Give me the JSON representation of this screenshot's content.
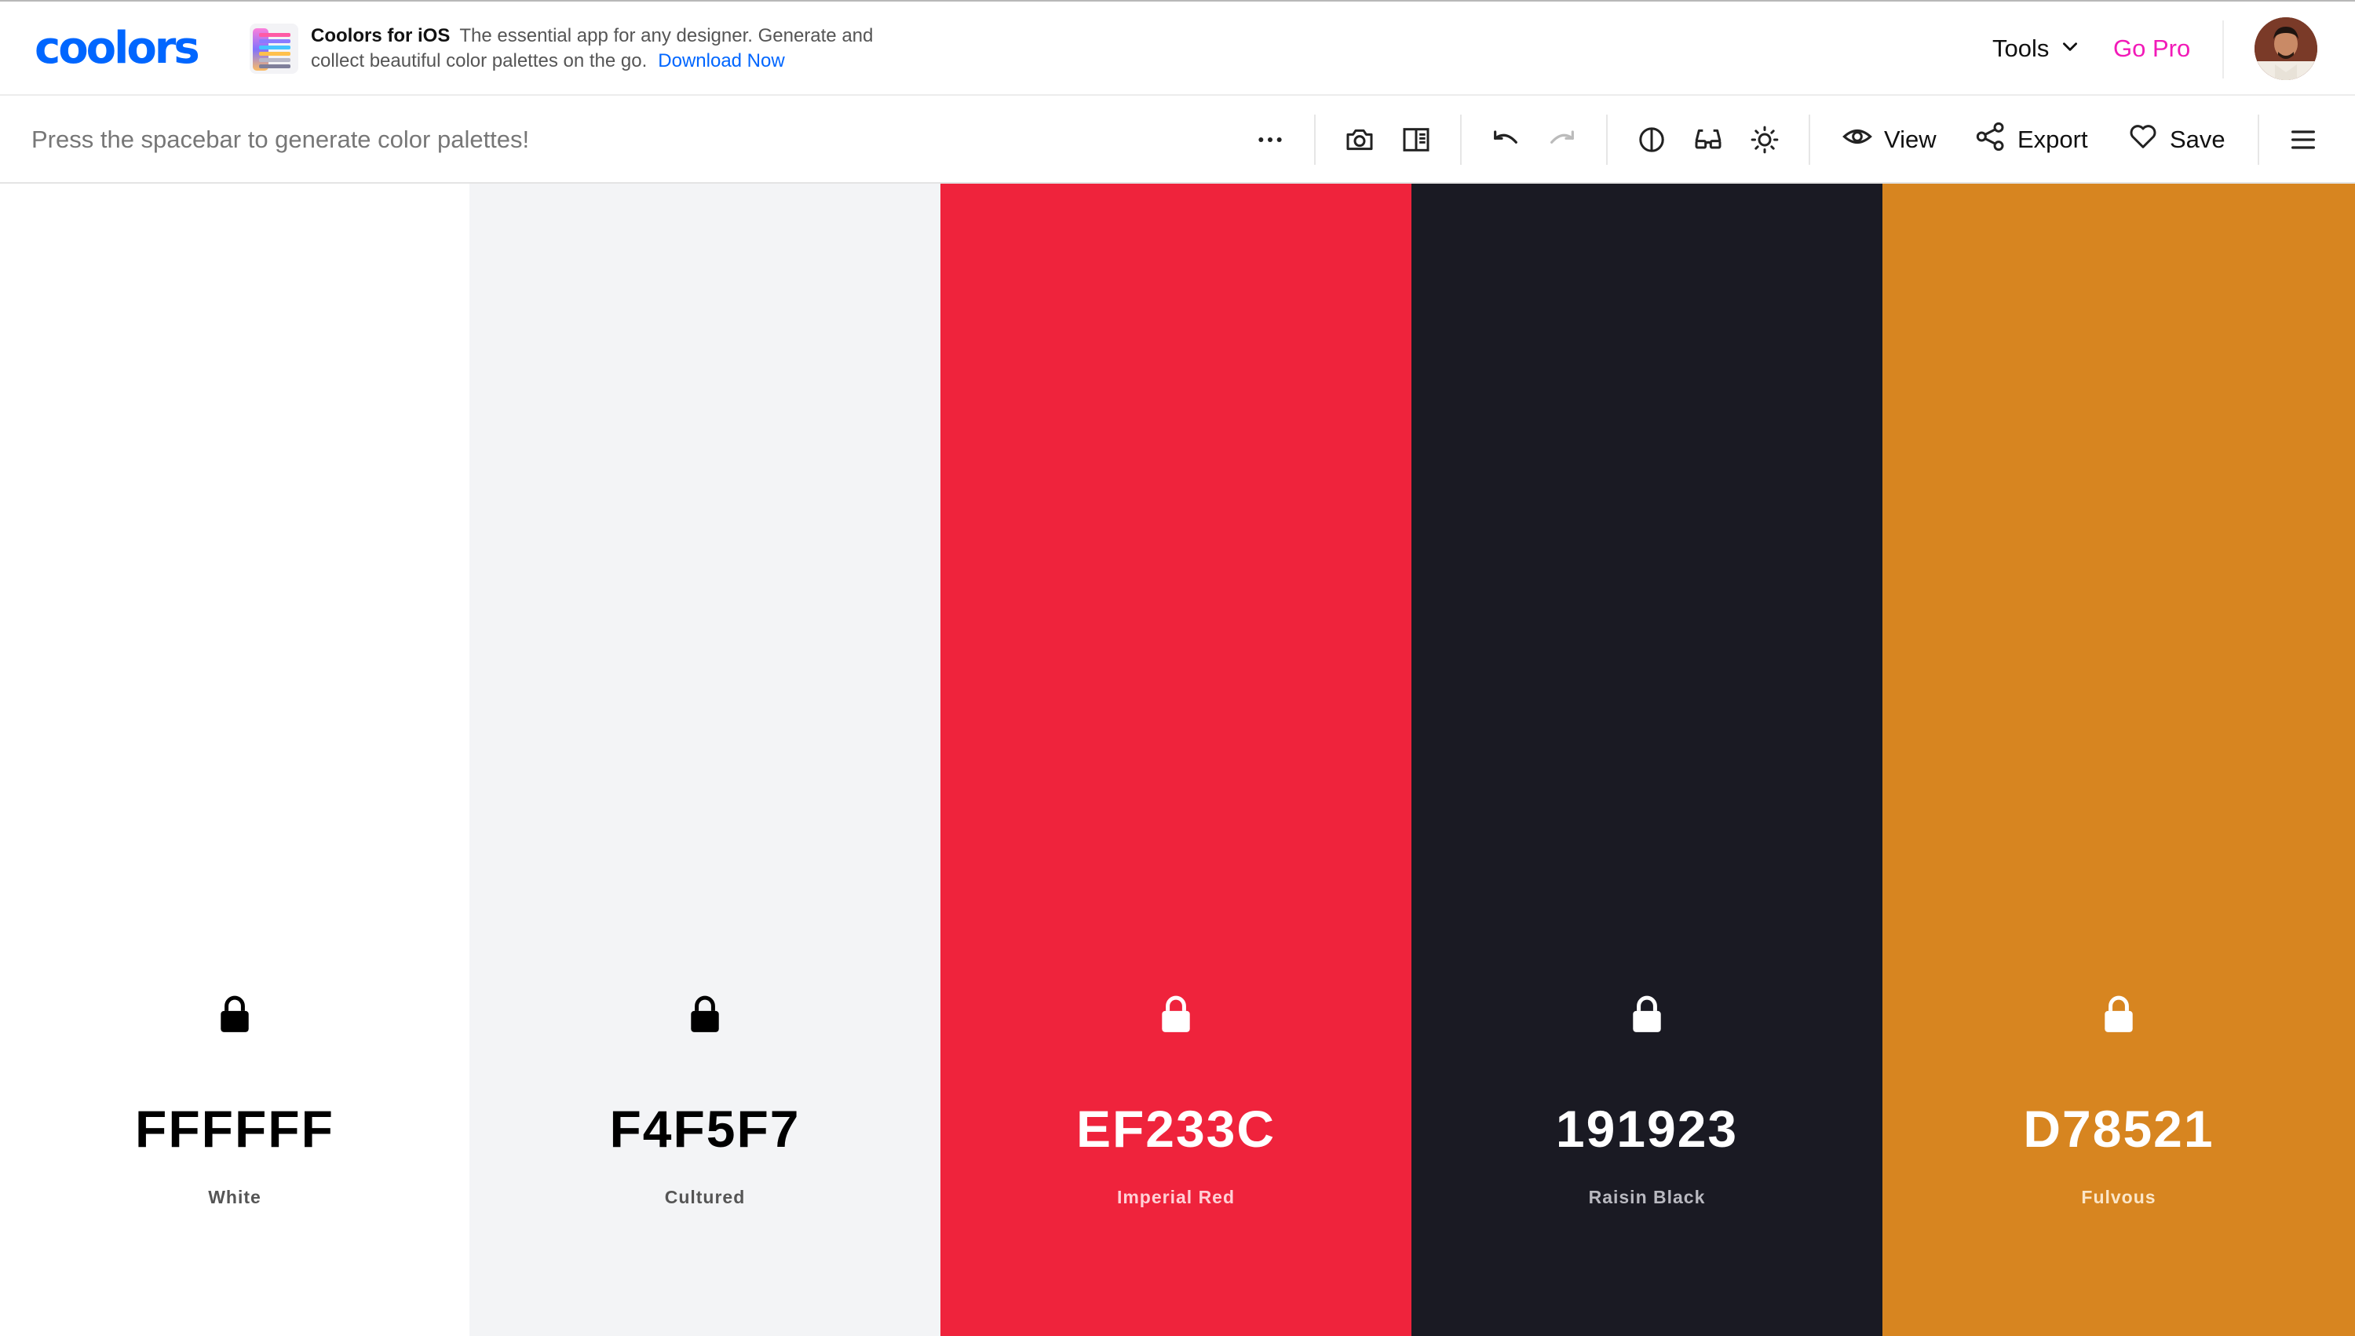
{
  "nav": {
    "logo": "coolors",
    "promo_title": "Coolors for iOS",
    "promo_text": "The essential app for any designer. Generate and collect beautiful color palettes on the go.",
    "promo_link": "Download Now",
    "tools_label": "Tools",
    "go_pro_label": "Go Pro",
    "brand_color": "#0066ff",
    "pro_color": "#f21ab8"
  },
  "toolbar": {
    "hint": "Press the spacebar to generate color palettes!",
    "icons": [
      "more-options-icon",
      "camera-icon",
      "book-icon",
      "undo-icon",
      "redo-icon",
      "contrast-icon",
      "glasses-icon",
      "brightness-icon",
      "eye-icon",
      "share-icon",
      "heart-icon",
      "hamburger-icon"
    ],
    "view_label": "View",
    "export_label": "Export",
    "save_label": "Save"
  },
  "palette": [
    {
      "hex": "FFFFFF",
      "name": "White",
      "bg": "#ffffff",
      "text_color": "#000000",
      "name_color": "#555555",
      "lock_color": "#000000"
    },
    {
      "hex": "F4F5F7",
      "name": "Cultured",
      "bg": "#f3f4f6",
      "text_color": "#000000",
      "name_color": "#555555",
      "lock_color": "#000000"
    },
    {
      "hex": "EF233C",
      "name": "Imperial Red",
      "bg": "#ef233c",
      "text_color": "#ffffff",
      "name_color": "#ffd0d6",
      "lock_color": "#ffffff"
    },
    {
      "hex": "191923",
      "name": "Raisin Black",
      "bg": "#1a1a23",
      "text_color": "#ffffff",
      "name_color": "#b9b9c0",
      "lock_color": "#ffffff"
    },
    {
      "hex": "D78521",
      "name": "Fulvous",
      "bg": "#d78520",
      "text_color": "#ffffff",
      "name_color": "#fbe6c8",
      "lock_color": "#ffffff"
    }
  ]
}
